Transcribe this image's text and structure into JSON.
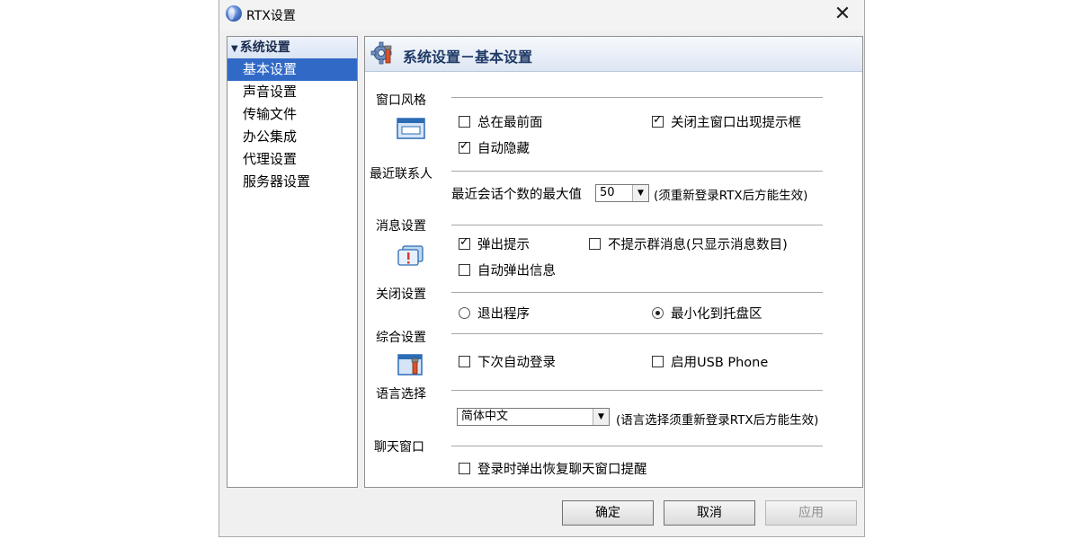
{
  "window": {
    "title": "RTX设置",
    "close_glyph": "✕"
  },
  "nav": {
    "header": "系统设置",
    "items": [
      "基本设置",
      "声音设置",
      "传输文件",
      "办公集成",
      "代理设置",
      "服务器设置"
    ],
    "selected_index": 0
  },
  "panel": {
    "title": "系统设置－基本设置",
    "sections": {
      "window_style": {
        "label": "窗口风格",
        "icon": "window-icon",
        "always_on_top": {
          "label": "总在最前面",
          "checked": false
        },
        "close_prompt": {
          "label": "关闭主窗口出现提示框",
          "checked": true
        },
        "auto_hide": {
          "label": "自动隐藏",
          "checked": true
        }
      },
      "recent_contacts": {
        "label": "最近联系人",
        "max_label": "最近会话个数的最大值",
        "max_value": "50",
        "note": "(须重新登录RTX后方能生效)"
      },
      "message": {
        "label": "消息设置",
        "icon": "message-icon",
        "popup": {
          "label": "弹出提示",
          "checked": true
        },
        "no_group_prompt": {
          "label": "不提示群消息(只显示消息数目)",
          "checked": false
        },
        "auto_popup": {
          "label": "自动弹出信息",
          "checked": false
        }
      },
      "close": {
        "label": "关闭设置",
        "exit": {
          "label": "退出程序",
          "selected": false
        },
        "minimize": {
          "label": "最小化到托盘区",
          "selected": true
        }
      },
      "general": {
        "label": "综合设置",
        "icon": "settings-window-icon",
        "auto_login": {
          "label": "下次自动登录",
          "checked": false
        },
        "usb_phone": {
          "label": "启用USB Phone",
          "checked": false
        }
      },
      "language": {
        "label": "语言选择",
        "value": "简体中文",
        "note": "(语言选择须重新登录RTX后方能生效)"
      },
      "chat": {
        "label": "聊天窗口",
        "restore_prompt": {
          "label": "登录时弹出恢复聊天窗口提醒",
          "checked": false
        }
      }
    }
  },
  "buttons": {
    "ok": "确定",
    "cancel": "取消",
    "apply": "应用"
  },
  "colors": {
    "selection": "#3169c6",
    "header_text": "#1f3a66"
  }
}
